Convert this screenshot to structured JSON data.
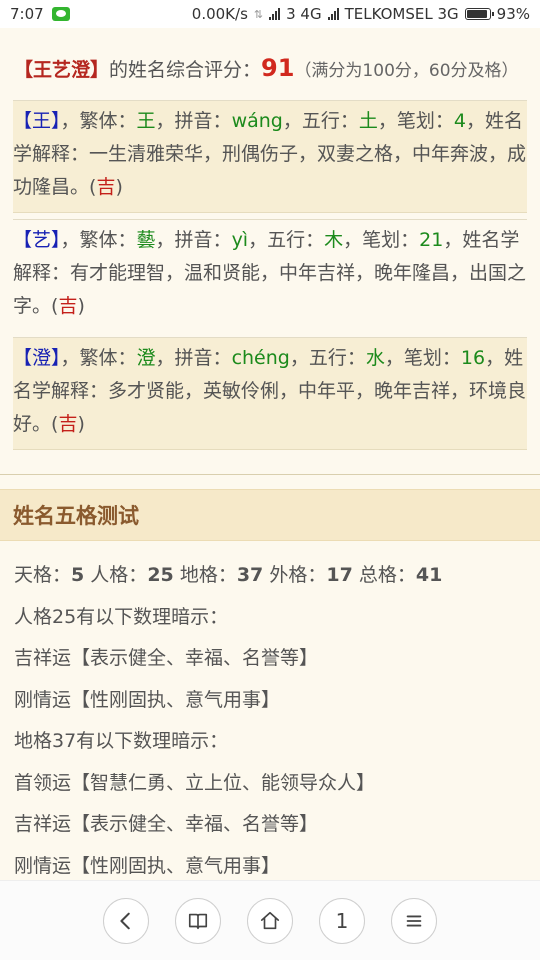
{
  "status": {
    "time": "7:07",
    "speed": "0.00K/s",
    "net1": "3 4G",
    "carrier": "TELKOMSEL 3G",
    "battery": "93%"
  },
  "summary": {
    "name_bracket": "【王艺澄】",
    "label": "的姓名综合评分：",
    "score": "91",
    "note": "（满分为100分，60分及格）"
  },
  "chars": [
    {
      "bracket": "【王】",
      "trad_label": "，繁体：",
      "trad": "王",
      "pinyin_label": "，拼音：",
      "pinyin": "wáng",
      "wuxing_label": "，五行：",
      "wuxing": "土",
      "bihua_label": "，笔划：",
      "bihua": "4",
      "tail": "，",
      "explain": "姓名学解释：一生清雅荣华，刑偶伤子，双妻之格，中年奔波，成功隆昌。",
      "luck": "吉"
    },
    {
      "bracket": "【艺】",
      "trad_label": "，繁体：",
      "trad": "藝",
      "pinyin_label": "，拼音：",
      "pinyin": "yì",
      "wuxing_label": "，五行：",
      "wuxing": "木",
      "bihua_label": "，笔划：",
      "bihua": "21",
      "tail": "，",
      "explain": "姓名学解释：有才能理智，温和贤能，中年吉祥，晚年隆昌，出国之字。",
      "luck": "吉"
    },
    {
      "bracket": "【澄】",
      "trad_label": "，繁体：",
      "trad": "澄",
      "pinyin_label": "，拼音：",
      "pinyin": "chéng",
      "wuxing_label": "，五行：",
      "wuxing": "水",
      "bihua_label": "，笔划：",
      "bihua": "16",
      "tail": "，",
      "explain": "姓名学解释：多才贤能，英敏伶俐，中年平，晚年吉祥，环境良好。",
      "luck": "吉"
    }
  ],
  "wuge": {
    "header": "姓名五格测试",
    "tian_label": "天格：",
    "tian": "5",
    "ren_label": "人格：",
    "ren": "25",
    "di_label": "地格：",
    "di": "37",
    "wai_label": "外格：",
    "wai": "17",
    "zong_label": "总格：",
    "zong": "41",
    "ren_hint": "人格25有以下数理暗示：",
    "ren_items": [
      "吉祥运【表示健全、幸福、名誉等】",
      "刚情运【性刚固执、意气用事】"
    ],
    "di_hint": "地格37有以下数理暗示：",
    "di_items": [
      "首领运【智慧仁勇、立上位、能领导众人】",
      "吉祥运【表示健全、幸福、名誉等】",
      "刚情运【性刚固执、意气用事】"
    ]
  },
  "nav": {
    "back_icon": "chevron-left-icon",
    "book_icon": "book-icon",
    "home_icon": "home-icon",
    "tabs_count": "1",
    "menu_icon": "menu-icon"
  },
  "colors": {
    "name_red": "#b5271f",
    "score_red": "#d1291e",
    "blue": "#1822b4",
    "green": "#1c8a1c",
    "header_bg": "#f6e9c9",
    "header_text": "#8a5a2e"
  }
}
